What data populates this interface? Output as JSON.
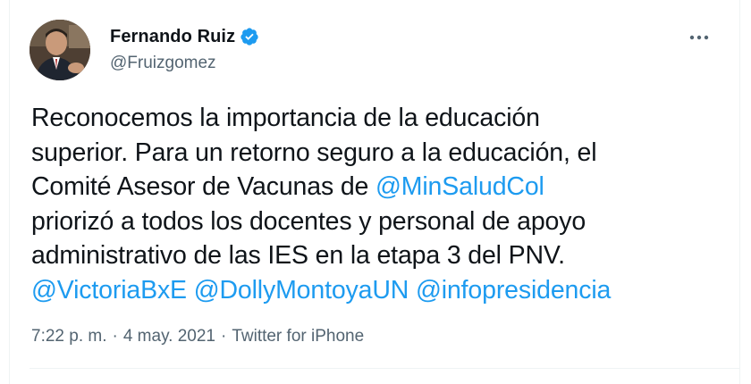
{
  "author": {
    "display_name": "Fernando Ruiz",
    "handle": "@Fruizgomez",
    "verified_icon": "verified-badge-icon",
    "avatar_icon": "profile-photo"
  },
  "more_icon": "more-options-icon",
  "tweet": {
    "lines": [
      [
        {
          "text": "Reconocemos la importancia de la educación",
          "type": "text"
        }
      ],
      [
        {
          "text": "superior. Para un retorno seguro a la educación, el",
          "type": "text"
        }
      ],
      [
        {
          "text": "Comité Asesor de Vacunas de ",
          "type": "text"
        },
        {
          "text": "@MinSaludCol",
          "type": "mention"
        }
      ],
      [
        {
          "text": "priorizó a todos los docentes y personal de apoyo",
          "type": "text"
        }
      ],
      [
        {
          "text": "administrativo de las IES en la etapa 3 del PNV.",
          "type": "text"
        }
      ],
      [
        {
          "text": "@VictoriaBxE",
          "type": "mention"
        },
        {
          "text": " ",
          "type": "text"
        },
        {
          "text": "@DollyMontoyaUN",
          "type": "mention"
        },
        {
          "text": " ",
          "type": "text"
        },
        {
          "text": "@infopresidencia",
          "type": "mention"
        }
      ]
    ]
  },
  "meta": {
    "time": "7:22 p. m.",
    "separator": "·",
    "date": "4 may. 2021",
    "source": "Twitter for iPhone"
  },
  "colors": {
    "mention": "#1d9bf0",
    "verified": "#1d9bf0",
    "secondary_text": "#536471"
  }
}
